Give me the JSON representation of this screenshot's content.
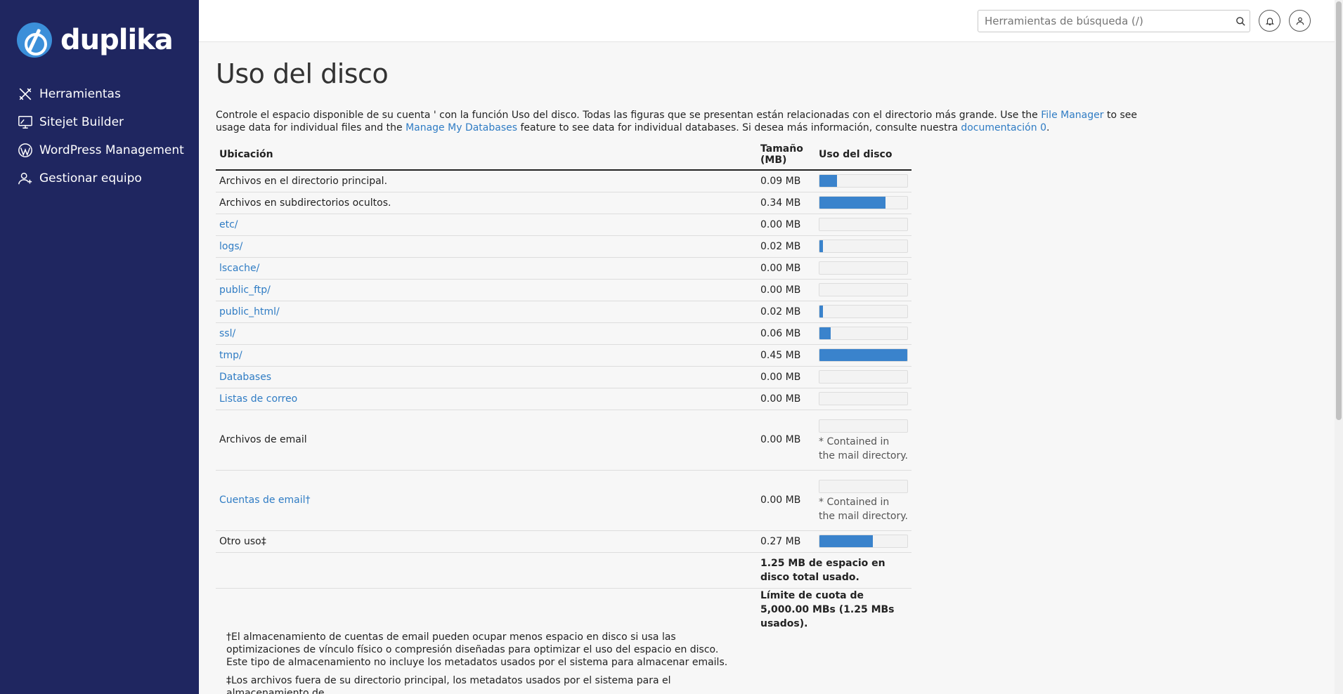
{
  "brand": {
    "name": "duplika"
  },
  "sidebar": {
    "items": [
      {
        "label": "Herramientas",
        "icon": "tools-icon"
      },
      {
        "label": "Sitejet Builder",
        "icon": "monitor-icon"
      },
      {
        "label": "WordPress Management",
        "icon": "wordpress-icon"
      },
      {
        "label": "Gestionar equipo",
        "icon": "user-add-icon"
      }
    ]
  },
  "header": {
    "search_placeholder": "Herramientas de búsqueda (/)"
  },
  "page": {
    "title": "Uso del disco",
    "intro_1": "Controle el espacio disponible de su cuenta ' con la función Uso del disco. Todas las figuras que se presentan están relacionadas con el directorio más grande. Use the ",
    "intro_link_1": "File Manager",
    "intro_2": " to see usage data for individual files and the ",
    "intro_link_2": "Manage My Databases",
    "intro_3": " feature to see data for individual databases. Si desea más información, consulte nuestra ",
    "intro_link_3": "documentación",
    "intro_4": ".",
    "doc_count": "0"
  },
  "table": {
    "headers": {
      "location": "Ubicación",
      "size": "Tamaño (MB)",
      "usage": "Uso del disco"
    },
    "rows": [
      {
        "location": "Archivos en el directorio principal.",
        "size": "0.09 MB",
        "fraction": 0.2,
        "link": false
      },
      {
        "location": "Archivos en subdirectorios ocultos.",
        "size": "0.34 MB",
        "fraction": 0.755,
        "link": false
      },
      {
        "location": "etc/",
        "size": "0.00 MB",
        "fraction": 0,
        "link": true
      },
      {
        "location": "logs/",
        "size": "0.02 MB",
        "fraction": 0.04,
        "link": true
      },
      {
        "location": "lscache/",
        "size": "0.00 MB",
        "fraction": 0,
        "link": true
      },
      {
        "location": "public_ftp/",
        "size": "0.00 MB",
        "fraction": 0,
        "link": true
      },
      {
        "location": "public_html/",
        "size": "0.02 MB",
        "fraction": 0.04,
        "link": true
      },
      {
        "location": "ssl/",
        "size": "0.06 MB",
        "fraction": 0.13,
        "link": true
      },
      {
        "location": "tmp/",
        "size": "0.45 MB",
        "fraction": 1.0,
        "link": true
      },
      {
        "location": "Databases",
        "size": "0.00 MB",
        "fraction": 0,
        "link": true
      },
      {
        "location": "Listas de correo",
        "size": "0.00 MB",
        "fraction": 0,
        "link": true
      },
      {
        "location": "Archivos de email",
        "size": "0.00 MB",
        "fraction": 0,
        "link": false,
        "note": "* Contained in the mail directory."
      },
      {
        "location": "Cuentas de email†",
        "size": "0.00 MB",
        "fraction": 0,
        "link": true,
        "note": "* Contained in the mail directory."
      },
      {
        "location": "Otro uso‡",
        "size": "0.27 MB",
        "fraction": 0.61,
        "link": false
      }
    ],
    "total": "1.25 MB de espacio en disco total usado.",
    "quota": "Límite de cuota de 5,000.00 MBs (1.25 MBs usados)."
  },
  "footnotes": [
    "†El almacenamiento de cuentas de email pueden ocupar menos espacio en disco si usa las optimizaciones de vínculo físico o compresión diseñadas para optimizar el uso del espacio en disco. Este tipo de almacenamiento no incluye los metadatos usados por el sistema para almacenar emails.",
    "‡Los archivos fuera de su directorio principal, los metadatos usados por el sistema para el almacenamiento de"
  ],
  "colors": {
    "sidebar": "#1f2660",
    "accent": "#3a83cc",
    "link": "#2f7cc4"
  }
}
